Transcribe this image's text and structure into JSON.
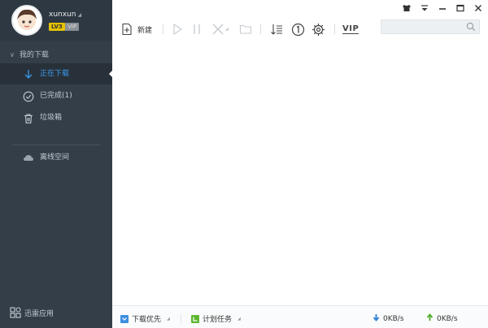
{
  "user": {
    "name": "xunxun",
    "level": "LV3",
    "vip": "VIP"
  },
  "sidebar": {
    "group_label": "我的下载",
    "items": [
      {
        "label": "正在下载",
        "icon": "download-icon",
        "active": true
      },
      {
        "label": "已完成(1)",
        "icon": "check-circle-icon",
        "active": false
      },
      {
        "label": "垃圾箱",
        "icon": "trash-icon",
        "active": false
      }
    ],
    "offline": {
      "label": "离线空间",
      "icon": "cloud-icon"
    },
    "apps": {
      "label": "迅雷应用",
      "icon": "apps-icon"
    }
  },
  "toolbar": {
    "new_label": "新建",
    "vip_label": "VIP",
    "icons": [
      "new-task-icon",
      "play-icon",
      "pause-icon",
      "delete-icon",
      "folder-icon",
      "sort-icon",
      "limit-one-icon",
      "settings-gear-icon",
      "vip-icon"
    ]
  },
  "search": {
    "placeholder": ""
  },
  "statusbar": {
    "priority_label": "下载优先",
    "schedule_label": "计划任务",
    "down_speed": "0KB/s",
    "up_speed": "0KB/s"
  },
  "colors": {
    "accent": "#3d9cf0",
    "sidebar_bg": "#333e48",
    "green": "#5cb82f"
  }
}
